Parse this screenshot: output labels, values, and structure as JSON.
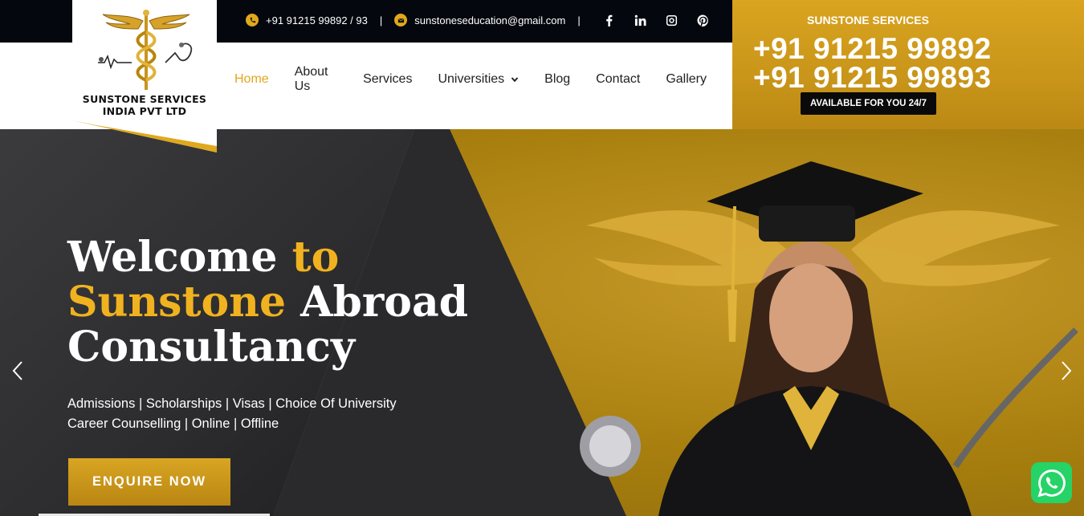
{
  "topbar": {
    "phone": "+91 91215 99892 / 93",
    "separator": "|",
    "email": "sunstoneseducation@gmail.com",
    "social": [
      "facebook-icon",
      "linkedin-icon",
      "instagram-icon",
      "pinterest-icon"
    ]
  },
  "logo": {
    "line1": "SUNSTONE SERVICES",
    "line2": "INDIA PVT LTD"
  },
  "nav": {
    "items": [
      {
        "label": "Home",
        "active": true
      },
      {
        "label": "About Us"
      },
      {
        "label": "Services"
      },
      {
        "label": "Universities",
        "dropdown": true
      },
      {
        "label": "Blog"
      },
      {
        "label": "Contact"
      },
      {
        "label": "Gallery"
      }
    ]
  },
  "contact": {
    "title": "SUNSTONE SERVICES",
    "phone1": "+91 91215 99892",
    "phone2": "+91 91215 99893",
    "availability": "AVAILABLE FOR YOU 24/7"
  },
  "hero": {
    "title_w1": "Welcome",
    "title_w2": "to",
    "title_w3": "Sunstone",
    "title_w4": "Abroad",
    "title_w5": "Consultancy",
    "sub_line1": "Admissions | Scholarships | Visas | Choice Of University",
    "sub_line2": "Career Counselling | Online | Offline",
    "cta": "ENQUIRE NOW"
  },
  "colors": {
    "accent": "#e0a81c",
    "dark": "#05070f"
  }
}
